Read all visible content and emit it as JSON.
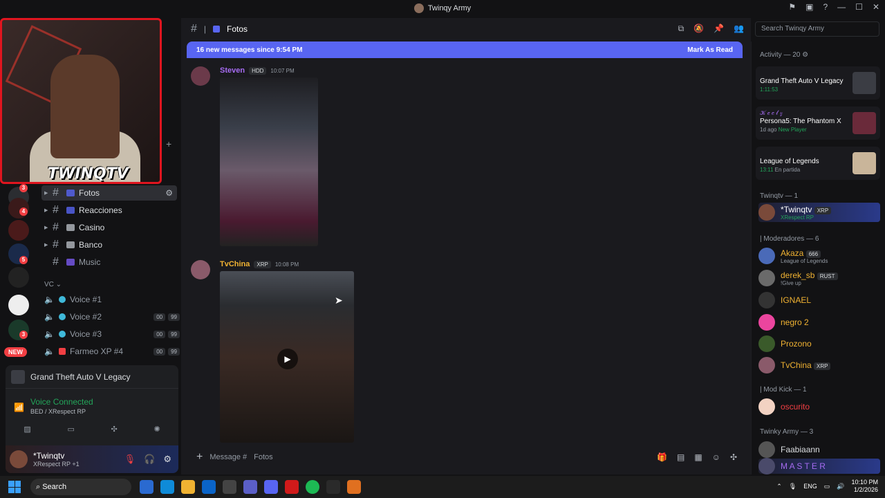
{
  "window": {
    "title": "Twinqy Army"
  },
  "webcam": {
    "logo_text": "TWINQTV"
  },
  "guild_badges": [
    "3",
    "4",
    "5",
    "3"
  ],
  "guild_new": "NEW",
  "channels": [
    {
      "name": "Fotos",
      "active": true
    },
    {
      "name": "Reacciones"
    },
    {
      "name": "Casino"
    },
    {
      "name": "Banco"
    },
    {
      "name": "Music",
      "dim": true
    }
  ],
  "vc": {
    "label": "VC",
    "channels": [
      {
        "name": "Voice #1"
      },
      {
        "name": "Voice #2",
        "n1": "00",
        "n2": "99"
      },
      {
        "name": "Voice #3",
        "n1": "00",
        "n2": "99"
      },
      {
        "name": "Farmeo XP #4",
        "n1": "00",
        "n2": "99"
      }
    ]
  },
  "panel": {
    "game": "Grand Theft Auto V Legacy",
    "voice_status": "Voice Connected",
    "voice_sub": "BED / XRespect RP",
    "user_name": "*Twinqtv",
    "user_sub": "XRespect RP +1"
  },
  "chat": {
    "channel": "Fotos",
    "new_messages": "16 new messages since 9:54 PM",
    "mark_read": "Mark As Read",
    "search_placeholder": "Search Twinqy Army",
    "composer_placeholder": "Message #",
    "composer_channel": "Fotos",
    "messages": [
      {
        "author": "Steven",
        "tag": "HDD",
        "time": "10:07 PM"
      },
      {
        "author": "TvChina",
        "tag": "XRP",
        "time": "10:08 PM"
      }
    ]
  },
  "members": {
    "activity_header": "Activity — 20",
    "activities": [
      {
        "who": "",
        "game": "Grand Theft Auto V Legacy",
        "meta": "1:11:53",
        "note": ""
      },
      {
        "who": "𝒦 𝑒 𝑒 𝓁 𝓏",
        "game": "Persona5: The Phantom X",
        "meta": "1d ago",
        "note": "New Player"
      },
      {
        "who": "",
        "game": "League of Legends",
        "meta": "13:11",
        "note": "En partida"
      }
    ],
    "group1": "Twinqtv — 1",
    "group1_members": [
      {
        "name": "*Twinqtv",
        "tag": "XRP",
        "sub": "XRespect RP"
      }
    ],
    "group2": "| Moderadores — 6",
    "group2_members": [
      {
        "name": "Akaza",
        "tag": "666",
        "sub": "League of Legends"
      },
      {
        "name": "derek_sb",
        "tag": "RUST",
        "sub": "!Give up"
      },
      {
        "name": "IGNAEL",
        "tag": "",
        "sub": ""
      },
      {
        "name": "negro 2",
        "tag": "",
        "sub": ""
      },
      {
        "name": "Prozono",
        "tag": "",
        "sub": ""
      },
      {
        "name": "TvChina",
        "tag": "XRP",
        "sub": ""
      }
    ],
    "group3": "| Mod Kick — 1",
    "group3_members": [
      {
        "name": "oscurito",
        "tag": "",
        "sub": ""
      }
    ],
    "group4": "Twinky Army — 3",
    "group4_members": [
      {
        "name": "Faabiaann",
        "tag": "",
        "sub": ""
      },
      {
        "name": "M A S T E R",
        "tag": "",
        "sub": ""
      }
    ]
  },
  "taskbar": {
    "search": "Search",
    "lang": "ENG",
    "time": "10:10 PM",
    "date": "1/2/2026"
  }
}
